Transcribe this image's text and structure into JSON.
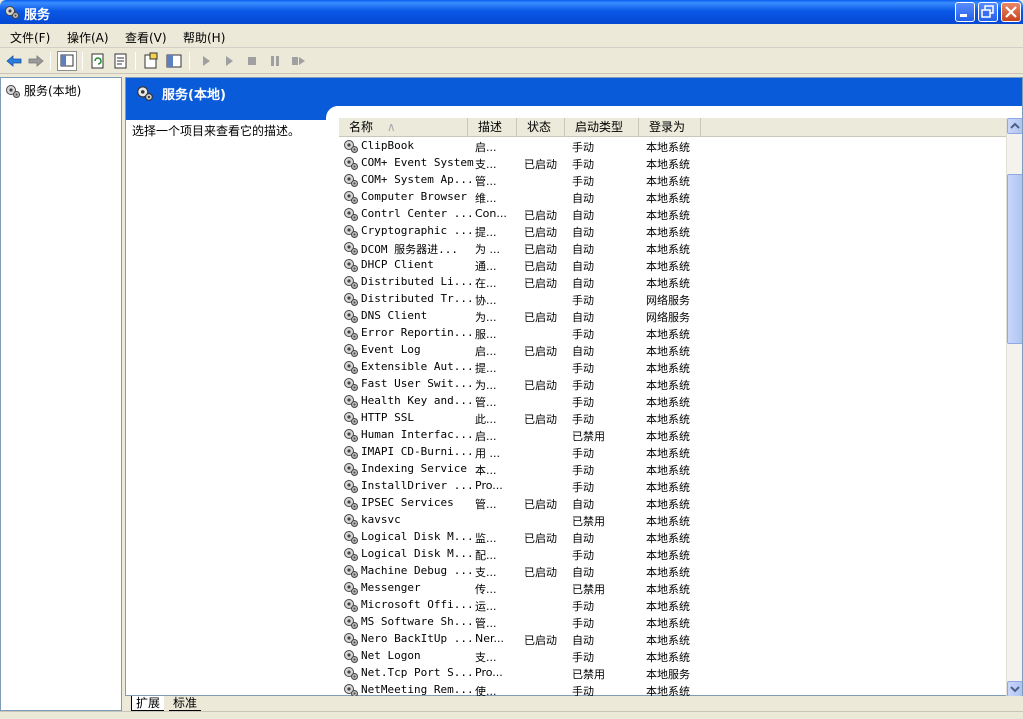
{
  "window": {
    "title": "服务"
  },
  "menu": [
    {
      "label": "文件(F)"
    },
    {
      "label": "操作(A)"
    },
    {
      "label": "查看(V)"
    },
    {
      "label": "帮助(H)"
    }
  ],
  "tree": {
    "root_label": "服务(本地)"
  },
  "pane": {
    "banner_title": "服务(本地)",
    "description": "选择一个项目来查看它的描述。"
  },
  "columns": {
    "name": "名称",
    "desc": "描述",
    "status": "状态",
    "startup": "启动类型",
    "logon": "登录为"
  },
  "services": [
    {
      "name": "ClipBook",
      "desc": "启...",
      "status": "",
      "startup": "手动",
      "logon": "本地系统"
    },
    {
      "name": "COM+ Event System",
      "desc": "支...",
      "status": "已启动",
      "startup": "手动",
      "logon": "本地系统"
    },
    {
      "name": "COM+ System Ap...",
      "desc": "管...",
      "status": "",
      "startup": "手动",
      "logon": "本地系统"
    },
    {
      "name": "Computer Browser",
      "desc": "维...",
      "status": "",
      "startup": "自动",
      "logon": "本地系统"
    },
    {
      "name": "Contrl Center ...",
      "desc": "Con...",
      "status": "已启动",
      "startup": "自动",
      "logon": "本地系统"
    },
    {
      "name": "Cryptographic ...",
      "desc": "提...",
      "status": "已启动",
      "startup": "自动",
      "logon": "本地系统"
    },
    {
      "name": "DCOM 服务器进...",
      "desc": "为 ...",
      "status": "已启动",
      "startup": "自动",
      "logon": "本地系统"
    },
    {
      "name": "DHCP Client",
      "desc": "通...",
      "status": "已启动",
      "startup": "自动",
      "logon": "本地系统"
    },
    {
      "name": "Distributed Li...",
      "desc": "在...",
      "status": "已启动",
      "startup": "自动",
      "logon": "本地系统"
    },
    {
      "name": "Distributed Tr...",
      "desc": "协...",
      "status": "",
      "startup": "手动",
      "logon": "网络服务"
    },
    {
      "name": "DNS Client",
      "desc": "为...",
      "status": "已启动",
      "startup": "自动",
      "logon": "网络服务"
    },
    {
      "name": "Error Reportin...",
      "desc": "服...",
      "status": "",
      "startup": "手动",
      "logon": "本地系统"
    },
    {
      "name": "Event Log",
      "desc": "启...",
      "status": "已启动",
      "startup": "自动",
      "logon": "本地系统"
    },
    {
      "name": "Extensible Aut...",
      "desc": "提...",
      "status": "",
      "startup": "手动",
      "logon": "本地系统"
    },
    {
      "name": "Fast User Swit...",
      "desc": "为...",
      "status": "已启动",
      "startup": "手动",
      "logon": "本地系统"
    },
    {
      "name": "Health Key and...",
      "desc": "管...",
      "status": "",
      "startup": "手动",
      "logon": "本地系统"
    },
    {
      "name": "HTTP SSL",
      "desc": "此...",
      "status": "已启动",
      "startup": "手动",
      "logon": "本地系统"
    },
    {
      "name": "Human Interfac...",
      "desc": "启...",
      "status": "",
      "startup": "已禁用",
      "logon": "本地系统"
    },
    {
      "name": "IMAPI CD-Burni...",
      "desc": "用 ...",
      "status": "",
      "startup": "手动",
      "logon": "本地系统"
    },
    {
      "name": "Indexing Service",
      "desc": "本...",
      "status": "",
      "startup": "手动",
      "logon": "本地系统"
    },
    {
      "name": "InstallDriver ...",
      "desc": "Pro...",
      "status": "",
      "startup": "手动",
      "logon": "本地系统"
    },
    {
      "name": "IPSEC Services",
      "desc": "管...",
      "status": "已启动",
      "startup": "自动",
      "logon": "本地系统"
    },
    {
      "name": "kavsvc",
      "desc": "",
      "status": "",
      "startup": "已禁用",
      "logon": "本地系统"
    },
    {
      "name": "Logical Disk M...",
      "desc": "监...",
      "status": "已启动",
      "startup": "自动",
      "logon": "本地系统"
    },
    {
      "name": "Logical Disk M...",
      "desc": "配...",
      "status": "",
      "startup": "手动",
      "logon": "本地系统"
    },
    {
      "name": "Machine Debug ...",
      "desc": "支...",
      "status": "已启动",
      "startup": "自动",
      "logon": "本地系统"
    },
    {
      "name": "Messenger",
      "desc": "传...",
      "status": "",
      "startup": "已禁用",
      "logon": "本地系统"
    },
    {
      "name": "Microsoft Offi...",
      "desc": "运...",
      "status": "",
      "startup": "手动",
      "logon": "本地系统"
    },
    {
      "name": "MS Software Sh...",
      "desc": "管...",
      "status": "",
      "startup": "手动",
      "logon": "本地系统"
    },
    {
      "name": "Nero BackItUp ...",
      "desc": "Ner...",
      "status": "已启动",
      "startup": "自动",
      "logon": "本地系统"
    },
    {
      "name": "Net Logon",
      "desc": "支...",
      "status": "",
      "startup": "手动",
      "logon": "本地系统"
    },
    {
      "name": "Net.Tcp Port S...",
      "desc": "Pro...",
      "status": "",
      "startup": "已禁用",
      "logon": "本地服务"
    },
    {
      "name": "NetMeeting Rem...",
      "desc": "使...",
      "status": "",
      "startup": "手动",
      "logon": "本地系统"
    }
  ],
  "tabs": [
    {
      "label": "扩展"
    },
    {
      "label": "标准"
    }
  ],
  "icons": {
    "service": "gears-icon",
    "back": "back-arrow-icon",
    "forward": "forward-arrow-icon"
  }
}
